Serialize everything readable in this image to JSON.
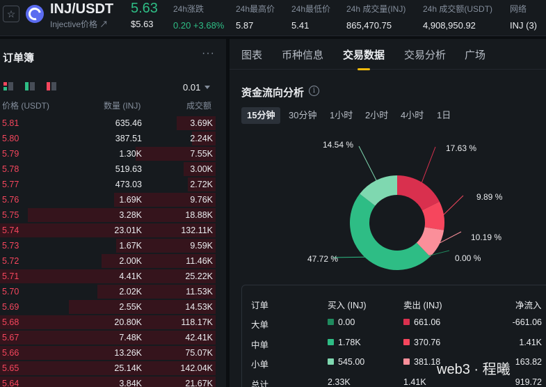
{
  "header": {
    "pair": "INJ/USDT",
    "subname": "Injective价格 ↗",
    "price": "5.63",
    "price_usd": "$5.63",
    "stats": [
      {
        "label": "24h涨跌",
        "value": "0.20 +3.68%"
      },
      {
        "label": "24h最高价",
        "value": "5.87"
      },
      {
        "label": "24h最低价",
        "value": "5.41"
      },
      {
        "label": "24h 成交量(INJ)",
        "value": "865,470.75"
      },
      {
        "label": "24h 成交额(USDT)",
        "value": "4,908,950.92"
      },
      {
        "label": "网络",
        "value": "INJ (3)"
      }
    ]
  },
  "orderbook": {
    "title": "订单簿",
    "more": "···",
    "precision": "0.01",
    "col_price": "价格 (USDT)",
    "col_qty": "数量 (INJ)",
    "col_total": "成交额",
    "rows": [
      {
        "price": "5.81",
        "qty": "635.46",
        "total": "3.69K",
        "depth": 0.18
      },
      {
        "price": "5.80",
        "qty": "387.51",
        "total": "2.24K",
        "depth": 0.11
      },
      {
        "price": "5.79",
        "qty": "1.30K",
        "total": "7.55K",
        "depth": 0.37
      },
      {
        "price": "5.78",
        "qty": "519.63",
        "total": "3.00K",
        "depth": 0.15
      },
      {
        "price": "5.77",
        "qty": "473.03",
        "total": "2.72K",
        "depth": 0.13
      },
      {
        "price": "5.76",
        "qty": "1.69K",
        "total": "9.76K",
        "depth": 0.47
      },
      {
        "price": "5.75",
        "qty": "3.28K",
        "total": "18.88K",
        "depth": 0.87
      },
      {
        "price": "5.74",
        "qty": "23.01K",
        "total": "132.11K",
        "depth": 1.0
      },
      {
        "price": "5.73",
        "qty": "1.67K",
        "total": "9.59K",
        "depth": 0.46
      },
      {
        "price": "5.72",
        "qty": "2.00K",
        "total": "11.46K",
        "depth": 0.53
      },
      {
        "price": "5.71",
        "qty": "4.41K",
        "total": "25.22K",
        "depth": 1.0
      },
      {
        "price": "5.70",
        "qty": "2.02K",
        "total": "11.53K",
        "depth": 0.55
      },
      {
        "price": "5.69",
        "qty": "2.55K",
        "total": "14.53K",
        "depth": 0.68
      },
      {
        "price": "5.68",
        "qty": "20.80K",
        "total": "118.17K",
        "depth": 1.0
      },
      {
        "price": "5.67",
        "qty": "7.48K",
        "total": "42.41K",
        "depth": 1.0
      },
      {
        "price": "5.66",
        "qty": "13.26K",
        "total": "75.07K",
        "depth": 1.0
      },
      {
        "price": "5.65",
        "qty": "25.14K",
        "total": "142.04K",
        "depth": 1.0
      },
      {
        "price": "5.64",
        "qty": "3.84K",
        "total": "21.67K",
        "depth": 1.0
      }
    ]
  },
  "tabs": [
    "图表",
    "币种信息",
    "交易数据",
    "交易分析",
    "广场"
  ],
  "active_tab": "交易数据",
  "fund_flow": {
    "title": "资金流向分析",
    "intervals": [
      "15分钟",
      "30分钟",
      "1小时",
      "2小时",
      "4小时",
      "1日"
    ],
    "active_interval": "15分钟",
    "labels": {
      "s1": "17.63 %",
      "s2": "9.89 %",
      "s3": "10.19 %",
      "s4": "0.00 %",
      "s5": "47.72 %",
      "s6": "14.54 %"
    },
    "table": {
      "headers": [
        "订单",
        "买入 (INJ)",
        "卖出 (INJ)",
        "净流入"
      ],
      "rows": [
        {
          "name": "大单",
          "buy": "0.00",
          "sell": "661.06",
          "net": "-661.06"
        },
        {
          "name": "中单",
          "buy": "1.78K",
          "sell": "370.76",
          "net": "1.41K"
        },
        {
          "name": "小单",
          "buy": "545.00",
          "sell": "381.18",
          "net": "163.82"
        },
        {
          "name": "总计",
          "buy": "2.33K",
          "sell": "1.41K",
          "net": "919.72"
        }
      ]
    }
  },
  "chart_data": {
    "type": "pie",
    "title": "资金流向分析",
    "categories": [
      "卖出 大单",
      "卖出 中单",
      "卖出 小单",
      "买入 大单",
      "买入 中单",
      "买入 小单"
    ],
    "values": [
      17.63,
      9.89,
      10.19,
      0.0,
      47.72,
      14.54
    ],
    "colors": [
      "#d9304e",
      "#f6465d",
      "#fb8f9a",
      "#1f8a5e",
      "#2ebd85",
      "#7fd8b0"
    ]
  },
  "watermark": "web3 · 程曦",
  "colors": {
    "up": "#2ebd85",
    "down": "#f6465d",
    "accent": "#f0b90b"
  }
}
